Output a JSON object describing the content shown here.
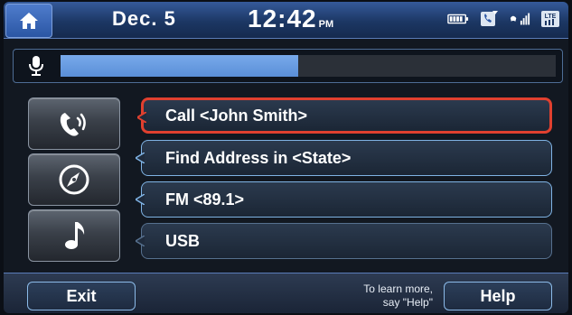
{
  "status_bar": {
    "date": "Dec. 5",
    "time": "12:42",
    "ampm": "PM",
    "icons": [
      "home-icon",
      "battery-icon",
      "phone-sync-icon",
      "signal-icon",
      "lte-icon"
    ]
  },
  "voice": {
    "icon": "microphone-icon",
    "progress": 0.48
  },
  "side_buttons": [
    {
      "icon": "phone-icon"
    },
    {
      "icon": "compass-icon"
    },
    {
      "icon": "music-note-icon"
    }
  ],
  "commands": [
    {
      "label": "Call <John Smith>"
    },
    {
      "label": "Find Address in <State>"
    },
    {
      "label": "FM <89.1>"
    },
    {
      "label": "USB"
    }
  ],
  "bottom": {
    "exit_label": "Exit",
    "hint_line1": "To learn more,",
    "hint_line2": "say \"Help\"",
    "help_label": "Help"
  },
  "colors": {
    "selection_border": "#e0402f",
    "progress_fill": "#6a9ee0",
    "accent_border": "#7fb3e4"
  }
}
